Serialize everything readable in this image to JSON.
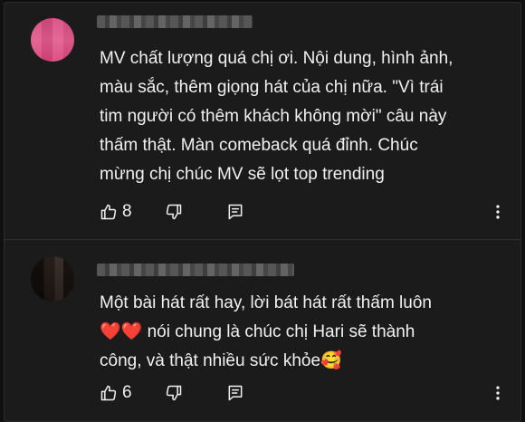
{
  "comments": [
    {
      "author": "",
      "text": "MV chất lượng quá chị ơi. Nội dung, hình ảnh,\nmàu sắc, thêm giọng hát của chị nữa. \"Vì trái\ntim người có thêm khách không mời\" câu này\nthấm thật. Màn comeback quá đỉnh. Chúc\nmừng chị  chúc MV sẽ lọt top trending",
      "likes": "8",
      "icons": {
        "like": "thumbs-up-icon",
        "dislike": "thumbs-down-icon",
        "reply": "reply-icon",
        "more": "more-vert-icon"
      }
    },
    {
      "author": "",
      "text_line1": "Một bài hát rất hay, lời bát hát rất thấm luôn",
      "text_line2_emoji": "❤️❤️",
      "text_line2": " nói chung là chúc chị Hari sẽ thành",
      "text_line3": "công, và thật nhiều sức khỏe",
      "text_line3_emoji": "🥰",
      "likes": "6",
      "icons": {
        "like": "thumbs-up-icon",
        "dislike": "thumbs-down-icon",
        "reply": "reply-icon",
        "more": "more-vert-icon"
      }
    }
  ],
  "colors": {
    "background": "#1b1b1b",
    "text": "#f1f1f1",
    "heart": "#e8202c"
  }
}
